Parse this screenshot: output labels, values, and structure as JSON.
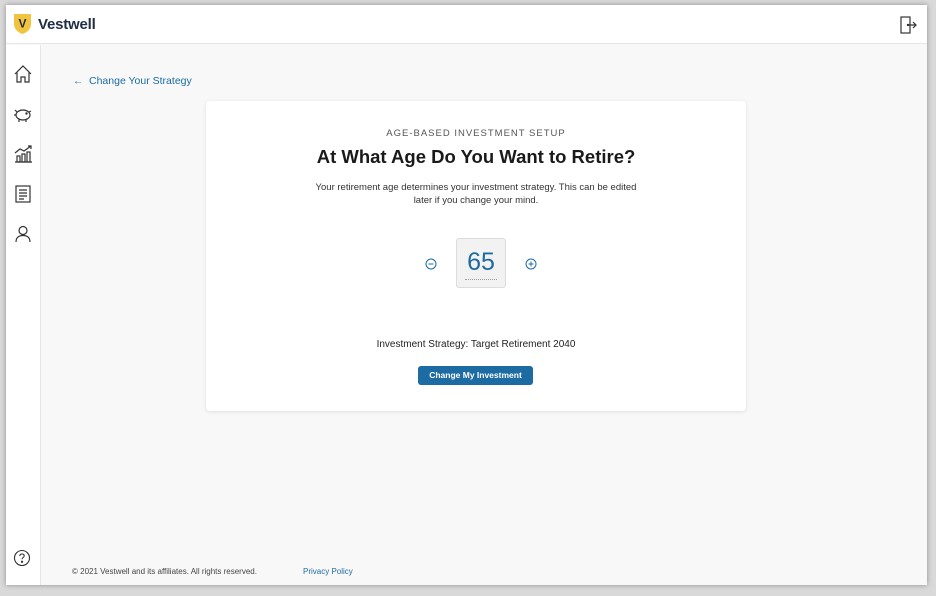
{
  "brand": {
    "name": "Vestwell",
    "logo_letter": "V",
    "colors": {
      "shield": "#f2c33d",
      "accent": "#1d6ba3",
      "text": "#1f2d45"
    }
  },
  "header": {
    "logout_icon": "logout-door-icon"
  },
  "sidebar": {
    "items": [
      {
        "icon": "home-icon"
      },
      {
        "icon": "piggy-bank-icon"
      },
      {
        "icon": "growth-chart-icon"
      },
      {
        "icon": "document-icon"
      },
      {
        "icon": "user-icon"
      }
    ],
    "help_icon": "help-circle-icon"
  },
  "back_link": {
    "label": "Change Your Strategy",
    "arrow": "←"
  },
  "card": {
    "eyebrow": "AGE-BASED INVESTMENT SETUP",
    "title": "At What Age Do You Want to Retire?",
    "description": "Your retirement age determines your investment strategy. This can be edited later if you change your mind.",
    "age_value": "65",
    "strategy_text": "Investment Strategy: Target Retirement 2040",
    "button_label": "Change My Investment"
  },
  "footer": {
    "copyright": "© 2021 Vestwell and its affiliates. All rights reserved.",
    "privacy_link": "Privacy Policy"
  }
}
